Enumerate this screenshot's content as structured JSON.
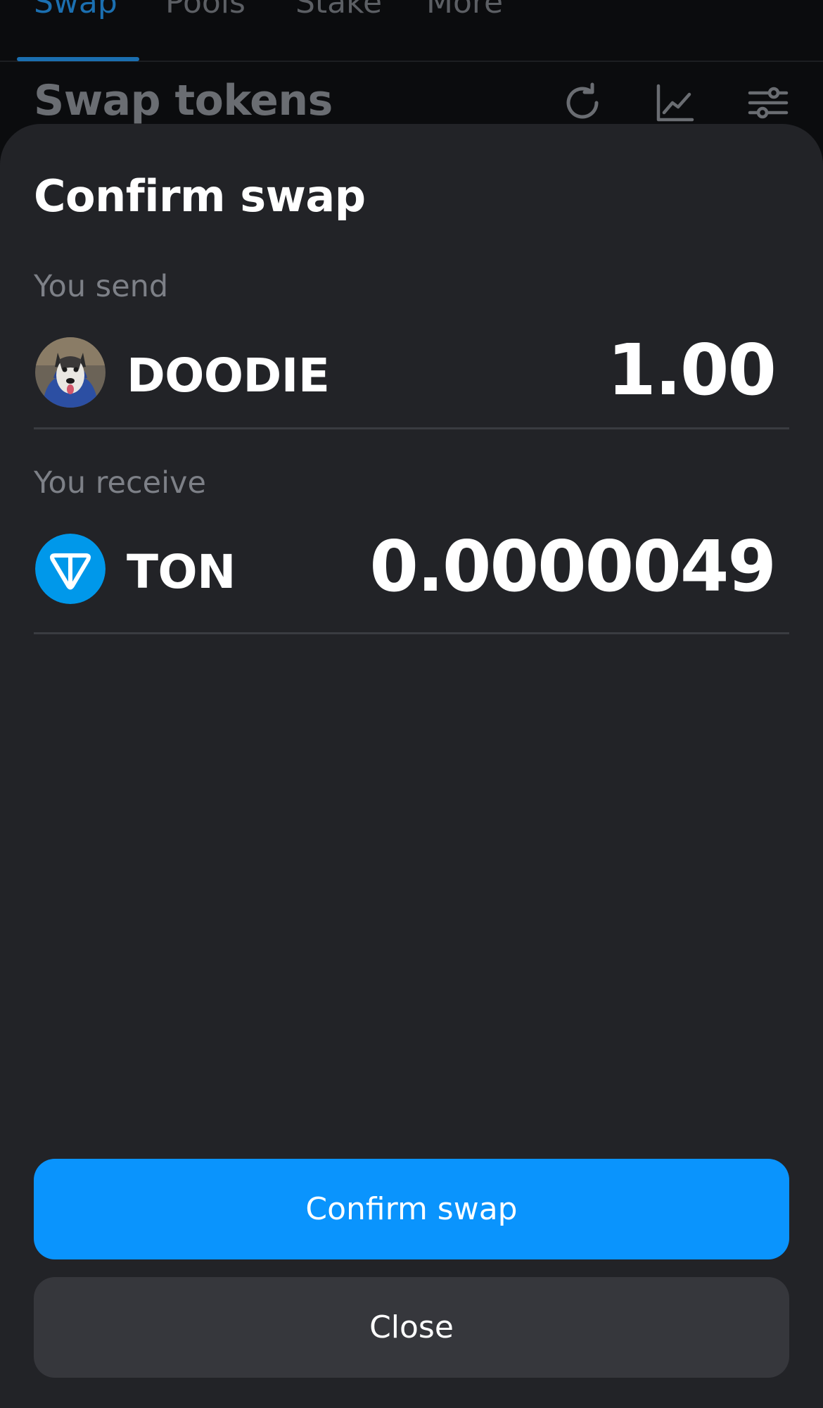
{
  "nav": {
    "tabs": [
      {
        "label": "Swap",
        "active": true
      },
      {
        "label": "Pools",
        "active": false
      },
      {
        "label": "Stake",
        "active": false
      },
      {
        "label": "More",
        "active": false
      }
    ]
  },
  "page": {
    "title": "Swap tokens",
    "icons": [
      "refresh-icon",
      "chart-icon",
      "settings-sliders-icon"
    ]
  },
  "sheet": {
    "title": "Confirm swap",
    "send": {
      "label": "You send",
      "symbol": "DOODIE",
      "amount": "1.00",
      "icon": "doodie-token-icon"
    },
    "receive": {
      "label": "You receive",
      "symbol": "TON",
      "amount": "0.0000049",
      "icon": "ton-token-icon"
    },
    "confirm_label": "Confirm swap",
    "close_label": "Close"
  },
  "colors": {
    "accent": "#0a94fd",
    "sheet_bg": "#222327",
    "close_bg": "#36373c",
    "ton_blue": "#0098ea"
  }
}
